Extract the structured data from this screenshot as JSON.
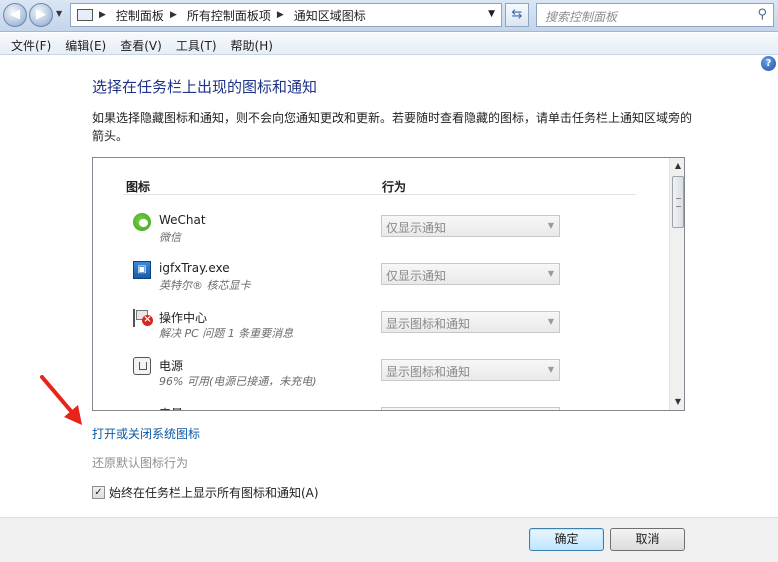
{
  "address_bar": {
    "breadcrumbs": [
      "控制面板",
      "所有控制面板项",
      "通知区域图标"
    ],
    "search_placeholder": "搜索控制面板"
  },
  "menu": {
    "items": [
      "文件(F)",
      "编辑(E)",
      "查看(V)",
      "工具(T)",
      "帮助(H)"
    ]
  },
  "content": {
    "title": "选择在任务栏上出现的图标和通知",
    "description": "如果选择隐藏图标和通知，则不会向您通知更改和更新。若要随时查看隐藏的图标，请单击任务栏上通知区域旁的箭头。",
    "columns": {
      "icon": "图标",
      "behavior": "行为"
    },
    "rows": [
      {
        "name": "WeChat",
        "sub": "微信",
        "behavior": "仅显示通知",
        "icon": "wechat-icon"
      },
      {
        "name": "igfxTray.exe",
        "sub": "英特尔® 核芯显卡",
        "behavior": "仅显示通知",
        "icon": "intel-graphics-icon"
      },
      {
        "name": "操作中心",
        "sub": "解决 PC 问题 1 条重要消息",
        "behavior": "显示图标和通知",
        "icon": "action-center-flag-icon"
      },
      {
        "name": "电源",
        "sub": "96% 可用(电源已接通，未充电)",
        "behavior": "显示图标和通知",
        "icon": "power-plug-icon"
      },
      {
        "name": "音量",
        "sub": "",
        "behavior": "",
        "icon": "speaker-icon"
      }
    ],
    "link_system_icons": "打开或关闭系统图标",
    "link_restore": "还原默认图标行为",
    "checkbox_label": "始终在任务栏上显示所有图标和通知(A)",
    "checkbox_checked": true
  },
  "buttons": {
    "ok": "确定",
    "cancel": "取消"
  },
  "colors": {
    "title": "#1e3287",
    "link": "#0b5aa6",
    "annotation_arrow": "#e8231c"
  }
}
